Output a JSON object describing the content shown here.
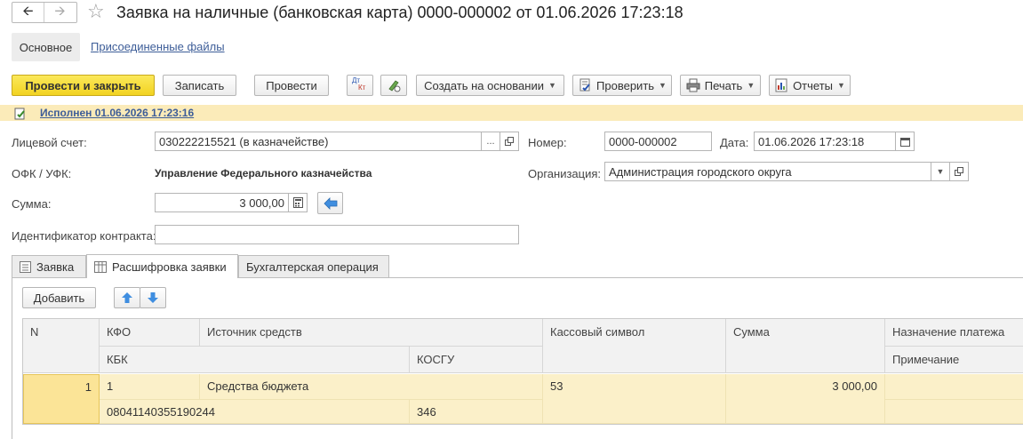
{
  "title": "Заявка на наличные (банковская карта) 0000-000002 от 01.06.2026 17:23:18",
  "view_tabs": {
    "main": "Основное",
    "files": "Присоединенные файлы"
  },
  "toolbar": {
    "post_close": "Провести и закрыть",
    "save": "Записать",
    "post": "Провести",
    "dtkt_d": "Дт",
    "dtkt_k": "Кт",
    "create_based": "Создать на основании",
    "check": "Проверить",
    "print": "Печать",
    "reports": "Отчеты"
  },
  "status": {
    "text": "Исполнен 01.06.2026 17:23:16"
  },
  "form": {
    "account_label": "Лицевой счет:",
    "account_value": "030222215521 (в казначействе)",
    "number_label": "Номер:",
    "number_value": "0000-000002",
    "date_label": "Дата:",
    "date_value": "01.06.2026 17:23:18",
    "ofk_label": "ОФК / УФК:",
    "ofk_value": "Управление Федерального казначейства",
    "org_label": "Организация:",
    "org_value": "Администрация городского округа",
    "sum_label": "Сумма:",
    "sum_value": "3 000,00",
    "contract_label": "Идентификатор контракта:",
    "contract_value": ""
  },
  "tabs": [
    "Заявка",
    "Расшифровка заявки",
    "Бухгалтерская операция"
  ],
  "table_toolbar": {
    "add": "Добавить"
  },
  "table": {
    "headers": {
      "n": "N",
      "kfo": "КФО",
      "source": "Источник средств",
      "kbk": "КБК",
      "kosgu": "КОСГУ",
      "cash_symbol": "Кассовый символ",
      "sum": "Сумма",
      "purpose": "Назначение платежа",
      "note": "Примечание"
    },
    "rows": [
      {
        "n": "1",
        "kfo": "1",
        "source": "Средства бюджета",
        "kbk": "08041140355190244",
        "kosgu": "346",
        "cash_symbol": "53",
        "sum": "3 000,00",
        "purpose": "",
        "note": ""
      }
    ]
  },
  "colors": {
    "primary": "#f5da2e",
    "status_bar": "#fbebb9",
    "row": "#fbf0c9",
    "link": "#3d5d98"
  }
}
